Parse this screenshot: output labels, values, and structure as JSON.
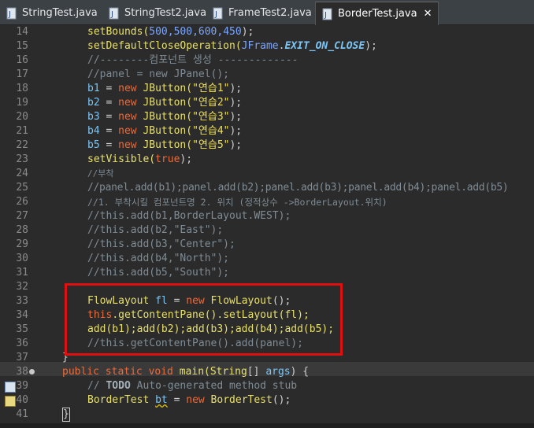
{
  "tabs": [
    {
      "label": "StringTest.java",
      "active": false
    },
    {
      "label": "StringTest2.java",
      "active": false
    },
    {
      "label": "FrameTest2.java",
      "active": false
    },
    {
      "label": "BorderTest.java",
      "active": true
    }
  ],
  "close_glyph": "✕",
  "lines": {
    "14": {
      "num": "14",
      "a": "setBounds(",
      "n": "500,500,600,450",
      "b": ");"
    },
    "15": {
      "num": "15",
      "a": "setDefaultCloseOperation(",
      "c": "JFrame",
      "d": ".",
      "e": "EXIT_ON_CLOSE",
      "f": ");"
    },
    "16": {
      "num": "16",
      "t": "//--------컴포넌트 생성 -------------"
    },
    "17": {
      "num": "17",
      "t": "//panel = new JPanel();"
    },
    "18": {
      "num": "18",
      "v": "b1",
      "eq": " = ",
      "kw": "new",
      "cls": "JButton(",
      "s": "\"연습1\"",
      "end": ");"
    },
    "19": {
      "num": "19",
      "v": "b2",
      "eq": " = ",
      "kw": "new",
      "cls": "JButton(",
      "s": "\"연습2\"",
      "end": ");"
    },
    "20": {
      "num": "20",
      "v": "b3",
      "eq": " = ",
      "kw": "new",
      "cls": "JButton(",
      "s": "\"연습3\"",
      "end": ");"
    },
    "21": {
      "num": "21",
      "v": "b4",
      "eq": " = ",
      "kw": "new",
      "cls": "JButton(",
      "s": "\"연습4\"",
      "end": ");"
    },
    "22": {
      "num": "22",
      "v": "b5",
      "eq": " = ",
      "kw": "new",
      "cls": "JButton(",
      "s": "\"연습5\"",
      "end": ");"
    },
    "23": {
      "num": "23",
      "a": "setVisible(",
      "kw": "true",
      "b": ");"
    },
    "24": {
      "num": "24",
      "t": "//부착"
    },
    "25": {
      "num": "25",
      "t": "//panel.add(b1);panel.add(b2);panel.add(b3);panel.add(b4);panel.add(b5)"
    },
    "26": {
      "num": "26",
      "t": "//1. 부착시킬 컴포넌트명 2. 위치 (정적상수 ->BorderLayout.위치)"
    },
    "27": {
      "num": "27",
      "t": "//this.add(b1,BorderLayout.WEST);"
    },
    "28": {
      "num": "28",
      "t": "//this.add(b2,\"East\");"
    },
    "29": {
      "num": "29",
      "t": "//this.add(b3,\"Center\");"
    },
    "30": {
      "num": "30",
      "t": "//this.add(b4,\"North\");"
    },
    "31": {
      "num": "31",
      "t": "//this.add(b5,\"South\");"
    },
    "32": {
      "num": "32"
    },
    "33": {
      "num": "33",
      "cls": "FlowLayout",
      "v": " fl",
      "eq": " = ",
      "kw": "new",
      "cls2": " FlowLayout",
      "end": "();"
    },
    "34": {
      "num": "34",
      "kw": "this",
      "rest": ".getContentPane().setLayout(fl);"
    },
    "35": {
      "num": "35",
      "t": "add(b1);add(b2);add(b3);add(b4);add(b5);"
    },
    "36": {
      "num": "36",
      "t": "//this.getContentPane().add(panel);"
    },
    "37": {
      "num": "37",
      "t": "}"
    },
    "38": {
      "num": "38",
      "kw": "public static void",
      "m": " main(",
      "cls": "String",
      "rest": "[] ",
      "p": "args",
      "end": ") {"
    },
    "39": {
      "num": "39",
      "c1": "// ",
      "todo": "TODO",
      "c2": " Auto-generated method stub"
    },
    "40": {
      "num": "40",
      "cls": "BorderTest",
      "sp": " ",
      "v": "bt",
      "eq": " = ",
      "kw": "new",
      "cls2": " BorderTest",
      "end": "();"
    },
    "41": {
      "num": "41",
      "t": "}"
    }
  }
}
